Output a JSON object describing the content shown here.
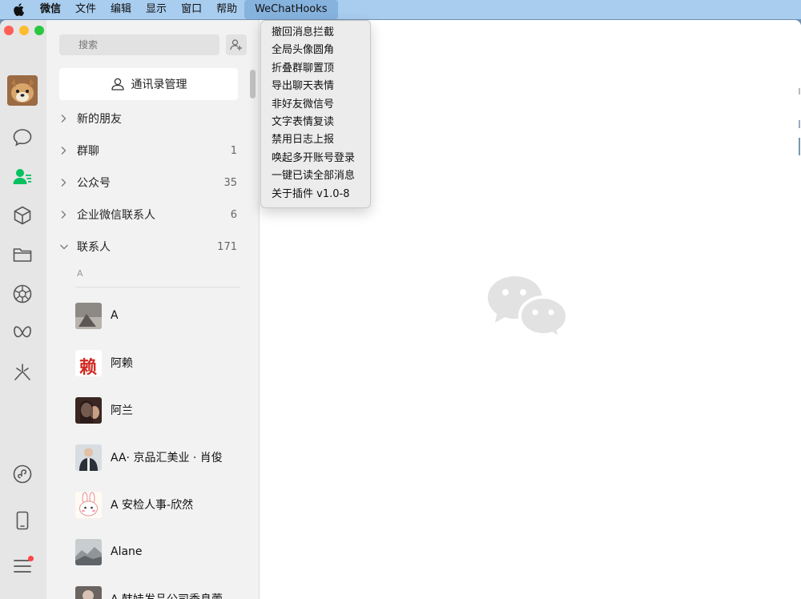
{
  "menubar": {
    "items": [
      "微信",
      "文件",
      "编辑",
      "显示",
      "窗口",
      "帮助",
      "WeChatHooks"
    ]
  },
  "dropdown": {
    "items": [
      "撤回消息拦截",
      "全局头像圆角",
      "折叠群聊置顶",
      "导出聊天表情",
      "非好友微信号",
      "文字表情复读",
      "禁用日志上报",
      "唤起多开账号登录",
      "一键已读全部消息",
      "关于插件 v1.0-8"
    ]
  },
  "search": {
    "placeholder": "搜索"
  },
  "contacts_manage": {
    "label": "通讯录管理"
  },
  "groups": [
    {
      "name": "新的朋友",
      "count": ""
    },
    {
      "name": "群聊",
      "count": "1"
    },
    {
      "name": "公众号",
      "count": "35"
    },
    {
      "name": "企业微信联系人",
      "count": "6"
    },
    {
      "name": "联系人",
      "count": "171"
    }
  ],
  "section_letter": "A",
  "contacts": [
    {
      "name": "A"
    },
    {
      "name": "阿赖",
      "avatar_text": "赖"
    },
    {
      "name": "阿兰"
    },
    {
      "name": "AA· 京品汇美业 · 肖俊"
    },
    {
      "name": "A 安检人事-欣然"
    },
    {
      "name": "Alane"
    },
    {
      "name": "A 韩娃发品公司季息蕾"
    }
  ],
  "colors": {
    "menubar_bg": "#a9cdef",
    "contact_active_green": "#07c160",
    "badge_red": "#f44"
  }
}
